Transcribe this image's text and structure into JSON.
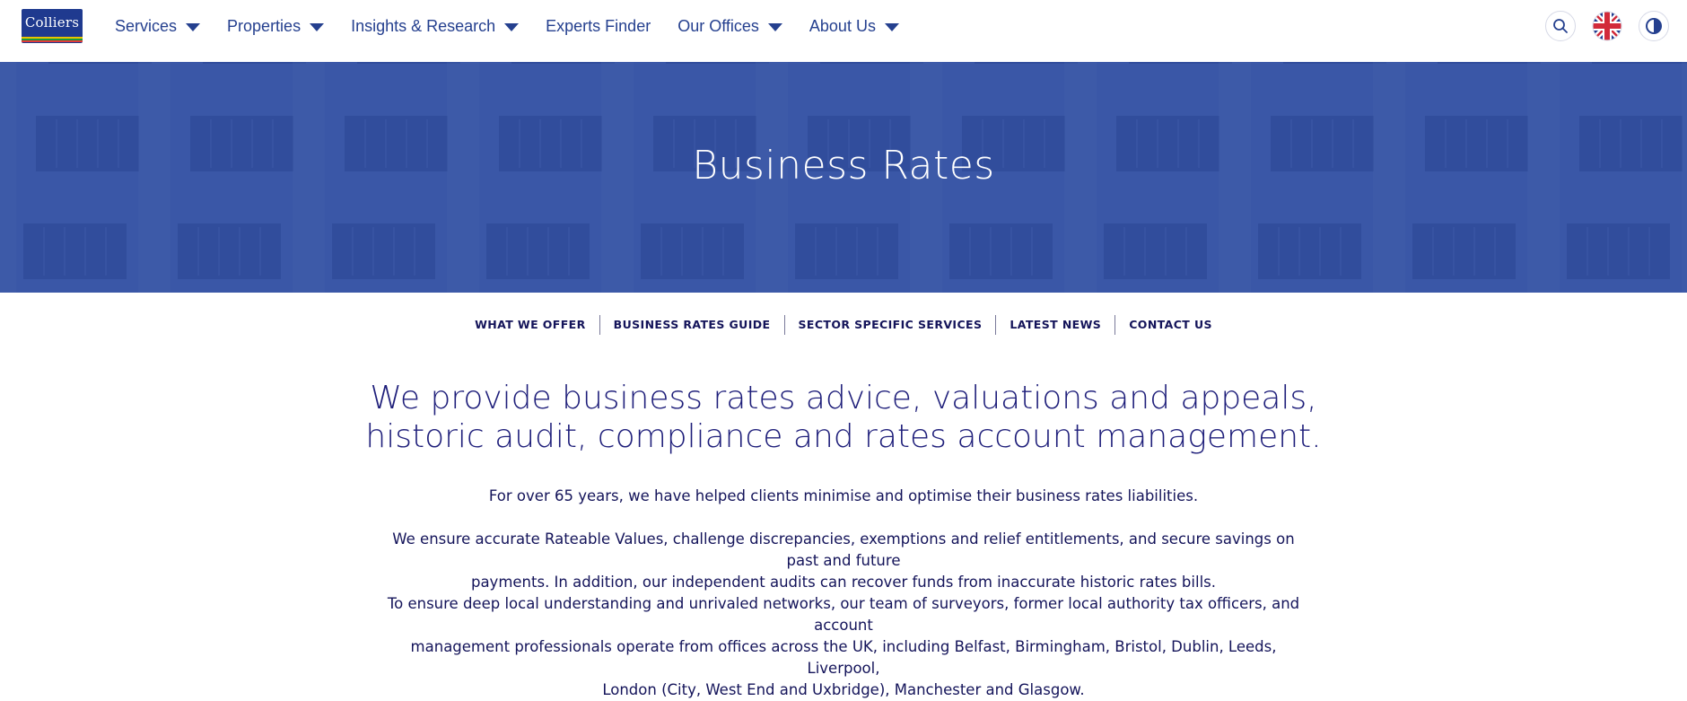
{
  "header": {
    "logo_text": "Colliers",
    "logo_stripe_colors": [
      "#e8c500",
      "#1a9a3a",
      "#e33a3a"
    ],
    "nav": [
      {
        "label": "Services",
        "has_dropdown": true
      },
      {
        "label": "Properties",
        "has_dropdown": true
      },
      {
        "label": "Insights & Research",
        "has_dropdown": true
      },
      {
        "label": "Experts Finder",
        "has_dropdown": false
      },
      {
        "label": "Our Offices",
        "has_dropdown": true
      },
      {
        "label": "About Us",
        "has_dropdown": true
      }
    ],
    "utility_icons": [
      "search-icon",
      "uk-flag-icon",
      "contrast-icon"
    ]
  },
  "hero": {
    "title": "Business Rates",
    "background_color": "#3a57a7"
  },
  "subnav": [
    "WHAT WE OFFER",
    "BUSINESS RATES GUIDE",
    "SECTOR SPECIFIC SERVICES",
    "LATEST NEWS",
    "CONTACT US"
  ],
  "content": {
    "headline_line1": "We provide business rates advice, valuations and appeals,",
    "headline_line2": "historic audit, compliance and rates account management.",
    "paragraph1": "For over 65 years, we have helped clients minimise and optimise their business rates liabilities.",
    "paragraph2_line1": "We ensure accurate Rateable Values, challenge discrepancies, exemptions and relief entitlements, and secure savings on past and future",
    "paragraph2_line2": "payments. In addition, our independent audits can recover funds from inaccurate historic rates bills.",
    "paragraph3_line1": "To ensure deep local understanding and unrivaled networks, our team of surveyors, former local authority tax officers, and account",
    "paragraph3_line2": "management professionals operate from offices across the UK, including Belfast, Birmingham, Bristol, Dublin, Leeds, Liverpool,",
    "paragraph3_line3": "London (City, West End and Uxbridge), Manchester and Glasgow."
  },
  "colors": {
    "brand_blue": "#1f3a8f",
    "nav_text": "#25408f",
    "body_text": "#14145a"
  }
}
